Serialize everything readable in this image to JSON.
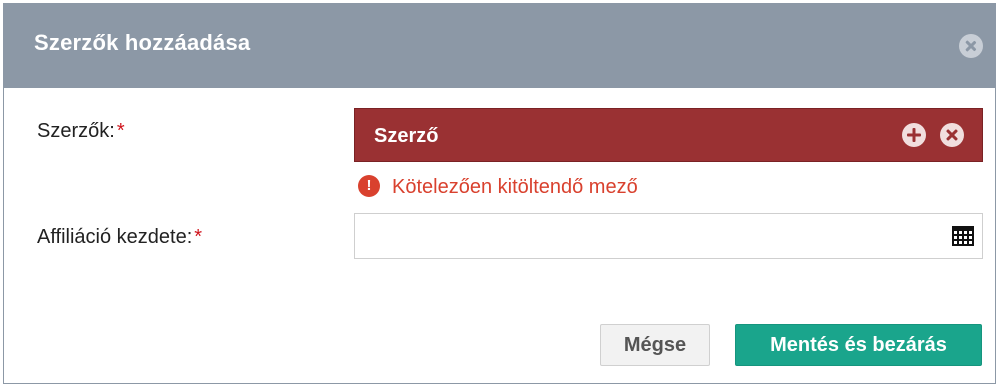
{
  "dialog": {
    "title": "Szerzők hozzáadása",
    "close_icon": "close-circle-icon"
  },
  "form": {
    "authors": {
      "label": "Szerzők:",
      "required_mark": "*",
      "placeholder": "Szerző",
      "add_icon": "plus-circle-icon",
      "remove_icon": "x-circle-icon",
      "error_icon": "exclamation-circle-icon",
      "error_text": "Kötelezően kitöltendő mező",
      "accent_color": "#9a3133",
      "error_color": "#d9412e"
    },
    "affiliation_start": {
      "label": "Affiliáció kezdete:",
      "required_mark": "*",
      "value": "",
      "calendar_icon": "calendar-grid-icon"
    }
  },
  "footer": {
    "cancel_label": "Mégse",
    "save_close_label": "Mentés és bezárás",
    "save_color": "#1aa58c"
  }
}
